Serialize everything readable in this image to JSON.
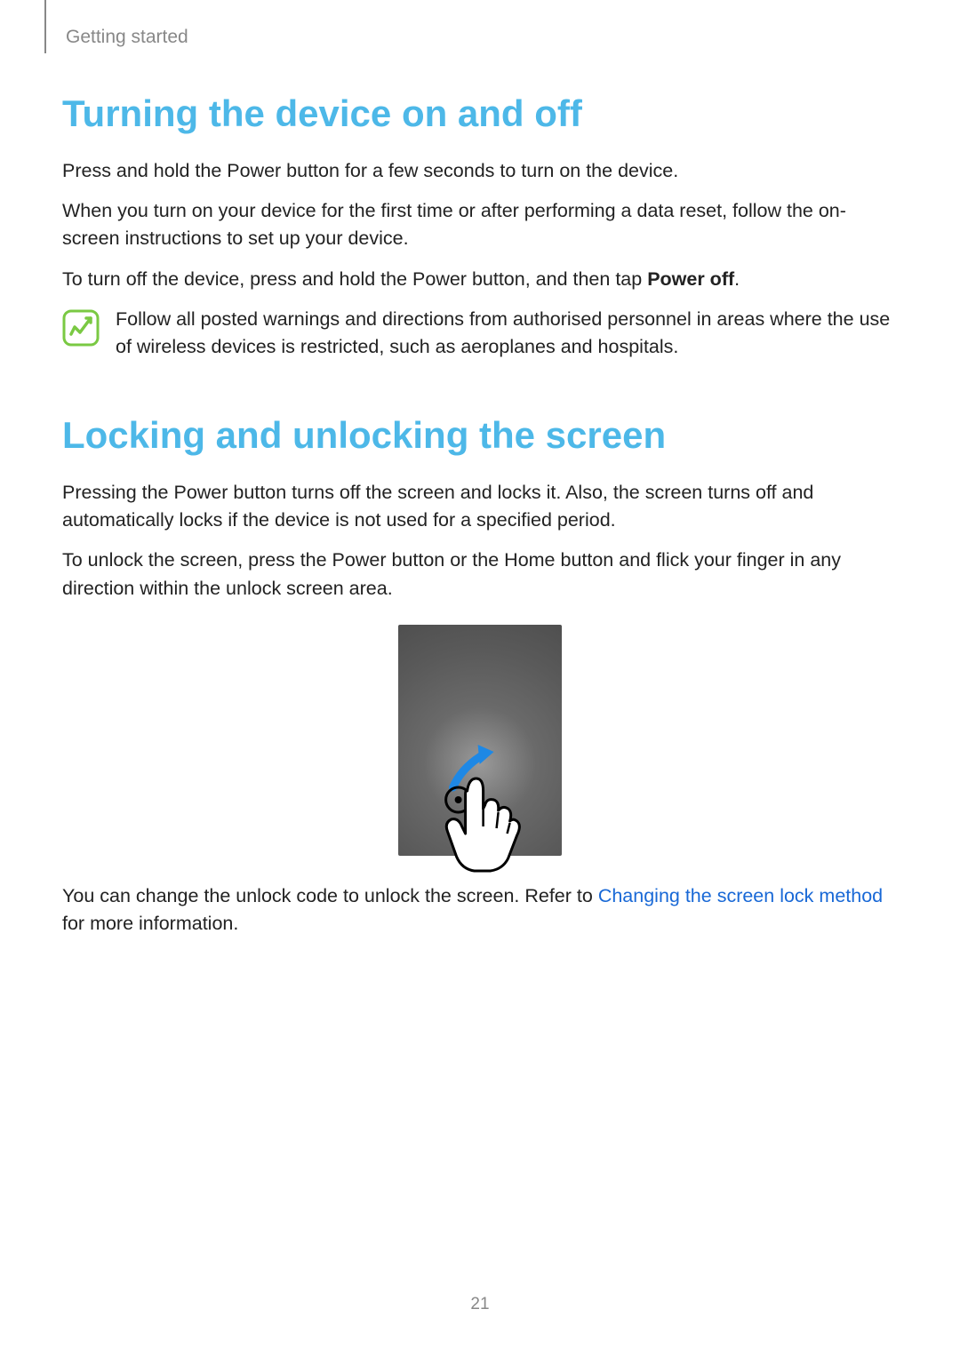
{
  "breadcrumb": "Getting started",
  "section1": {
    "heading": "Turning the device on and off",
    "p1": "Press and hold the Power button for a few seconds to turn on the device.",
    "p2": "When you turn on your device for the first time or after performing a data reset, follow the on-screen instructions to set up your device.",
    "p3_pre": "To turn off the device, press and hold the Power button, and then tap ",
    "p3_bold": "Power off",
    "p3_post": ".",
    "note": "Follow all posted warnings and directions from authorised personnel in areas where the use of wireless devices is restricted, such as aeroplanes and hospitals."
  },
  "section2": {
    "heading": "Locking and unlocking the screen",
    "p1": "Pressing the Power button turns off the screen and locks it. Also, the screen turns off and automatically locks if the device is not used for a specified period.",
    "p2": "To unlock the screen, press the Power button or the Home button and flick your finger in any direction within the unlock screen area.",
    "p3_pre": "You can change the unlock code to unlock the screen. Refer to ",
    "p3_link": "Changing the screen lock method",
    "p3_post": " for more information."
  },
  "pageNumber": "21"
}
